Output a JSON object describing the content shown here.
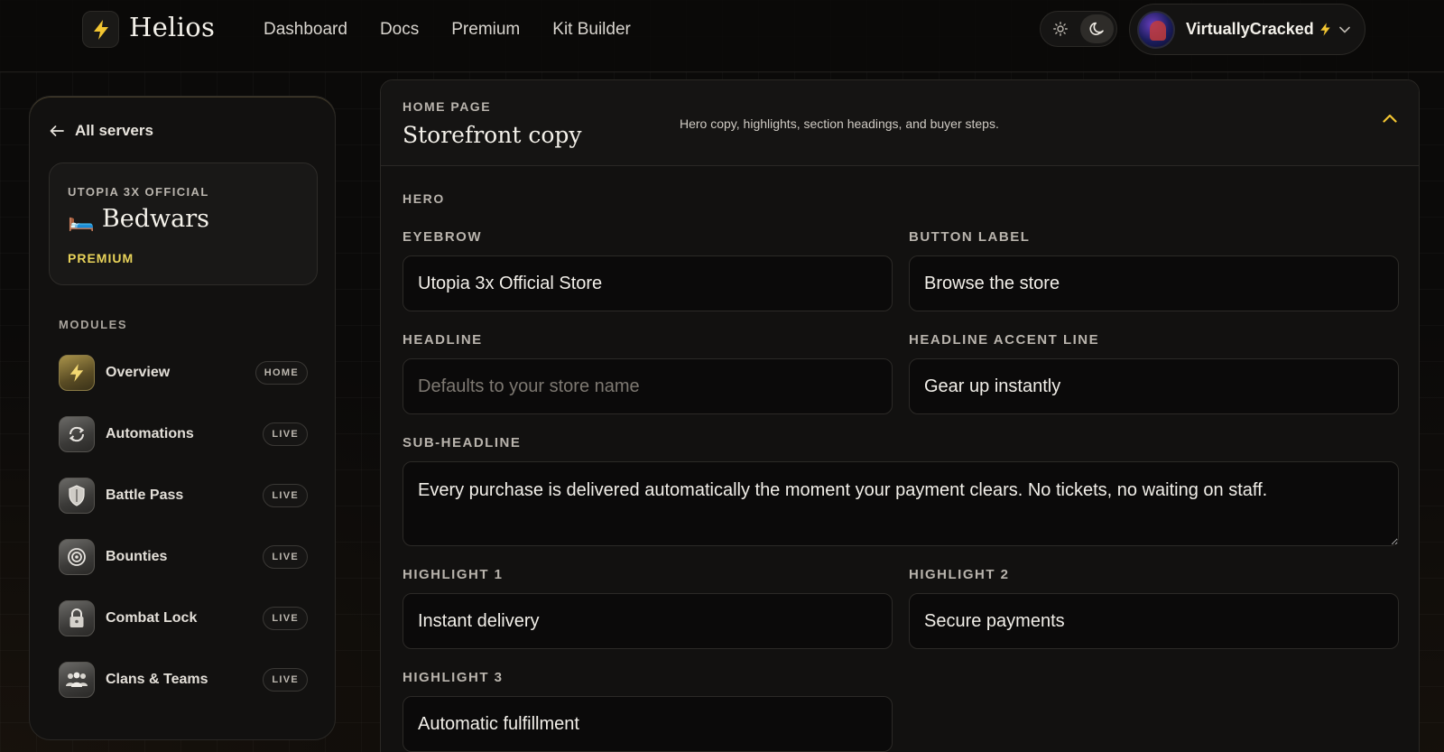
{
  "app": {
    "brand": "Helios"
  },
  "nav": {
    "items": [
      "Dashboard",
      "Docs",
      "Premium",
      "Kit Builder"
    ]
  },
  "user": {
    "name": "VirtuallyCracked"
  },
  "sidebar": {
    "back_label": "All servers",
    "server": {
      "network": "UTOPIA 3X OFFICIAL",
      "emoji": "🛏️",
      "name": "Bedwars",
      "tier": "PREMIUM"
    },
    "modules_label": "MODULES",
    "modules": [
      {
        "label": "Overview",
        "badge": "HOME",
        "icon": "lightning-icon"
      },
      {
        "label": "Automations",
        "badge": "LIVE",
        "icon": "cycle-icon"
      },
      {
        "label": "Battle Pass",
        "badge": "LIVE",
        "icon": "shield-icon"
      },
      {
        "label": "Bounties",
        "badge": "LIVE",
        "icon": "target-icon"
      },
      {
        "label": "Combat Lock",
        "badge": "LIVE",
        "icon": "lock-icon"
      },
      {
        "label": "Clans & Teams",
        "badge": "LIVE",
        "icon": "team-icon"
      }
    ]
  },
  "panel": {
    "eyebrow": "HOME PAGE",
    "title": "Storefront copy",
    "description": "Hero copy, highlights, section headings, and buyer steps.",
    "section": "HERO",
    "fields": {
      "eyebrow": {
        "label": "EYEBROW",
        "value": "Utopia 3x Official Store",
        "placeholder": ""
      },
      "button_label": {
        "label": "BUTTON LABEL",
        "value": "Browse the store",
        "placeholder": ""
      },
      "headline": {
        "label": "HEADLINE",
        "value": "",
        "placeholder": "Defaults to your store name"
      },
      "headline_accent": {
        "label": "HEADLINE ACCENT LINE",
        "value": "Gear up instantly",
        "placeholder": ""
      },
      "subheadline": {
        "label": "SUB-HEADLINE",
        "value": "Every purchase is delivered automatically the moment your payment clears. No tickets, no waiting on staff."
      },
      "highlight1": {
        "label": "HIGHLIGHT 1",
        "value": "Instant delivery"
      },
      "highlight2": {
        "label": "HIGHLIGHT 2",
        "value": "Secure payments"
      },
      "highlight3": {
        "label": "HIGHLIGHT 3",
        "value": "Automatic fulfillment"
      }
    }
  },
  "colors": {
    "accent": "#f2c531",
    "premium": "#e9d35a",
    "background": "#0b0a09"
  }
}
